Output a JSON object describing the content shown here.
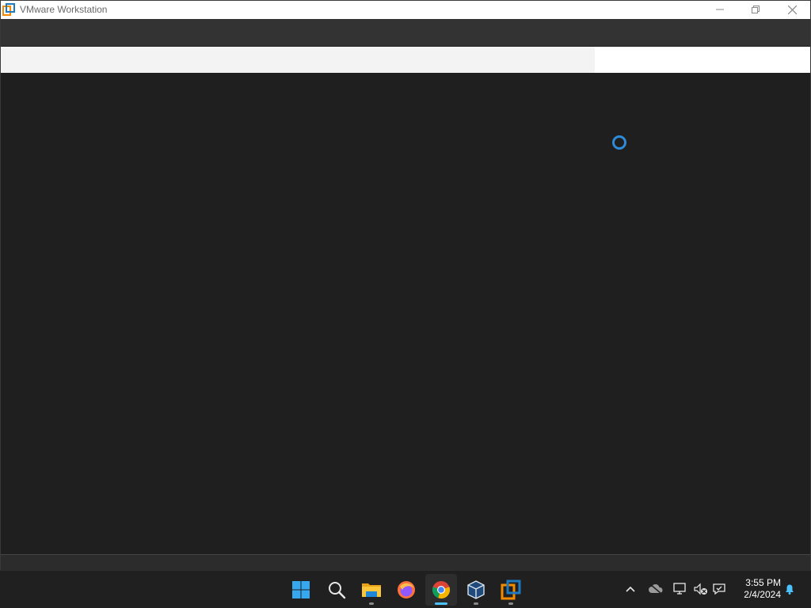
{
  "window": {
    "title": "VMware Workstation",
    "controls": [
      "minimize",
      "restore",
      "close"
    ]
  },
  "vm_display": {
    "state_icon": "loading-spinner-icon"
  },
  "taskbar": {
    "pinned": [
      {
        "name": "start-button",
        "icon": "windows-logo-icon",
        "running": false,
        "active": false
      },
      {
        "name": "search-button",
        "icon": "search-icon",
        "running": false,
        "active": false
      },
      {
        "name": "file-explorer-button",
        "icon": "folder-icon",
        "running": true,
        "active": false
      },
      {
        "name": "firefox-button",
        "icon": "firefox-icon",
        "running": false,
        "active": false
      },
      {
        "name": "chrome-button",
        "icon": "chrome-icon",
        "running": true,
        "active": true
      },
      {
        "name": "virtualbox-button",
        "icon": "virtualbox-icon",
        "running": true,
        "active": false
      },
      {
        "name": "vmware-button",
        "icon": "vmware-icon",
        "running": true,
        "active": false
      }
    ],
    "tray": {
      "icons": [
        "chevron-up-icon",
        "cloud-offline-icon",
        "network-icon",
        "volume-muted-icon",
        "chat-icon",
        "notification-bell-icon"
      ],
      "time": "3:55 PM",
      "date": "2/4/2024"
    }
  },
  "colors": {
    "accent": "#4cc2ff",
    "spinner": "#2f8ad8",
    "vmware_orange": "#f38b00",
    "vmware_blue": "#1d7ac0"
  }
}
